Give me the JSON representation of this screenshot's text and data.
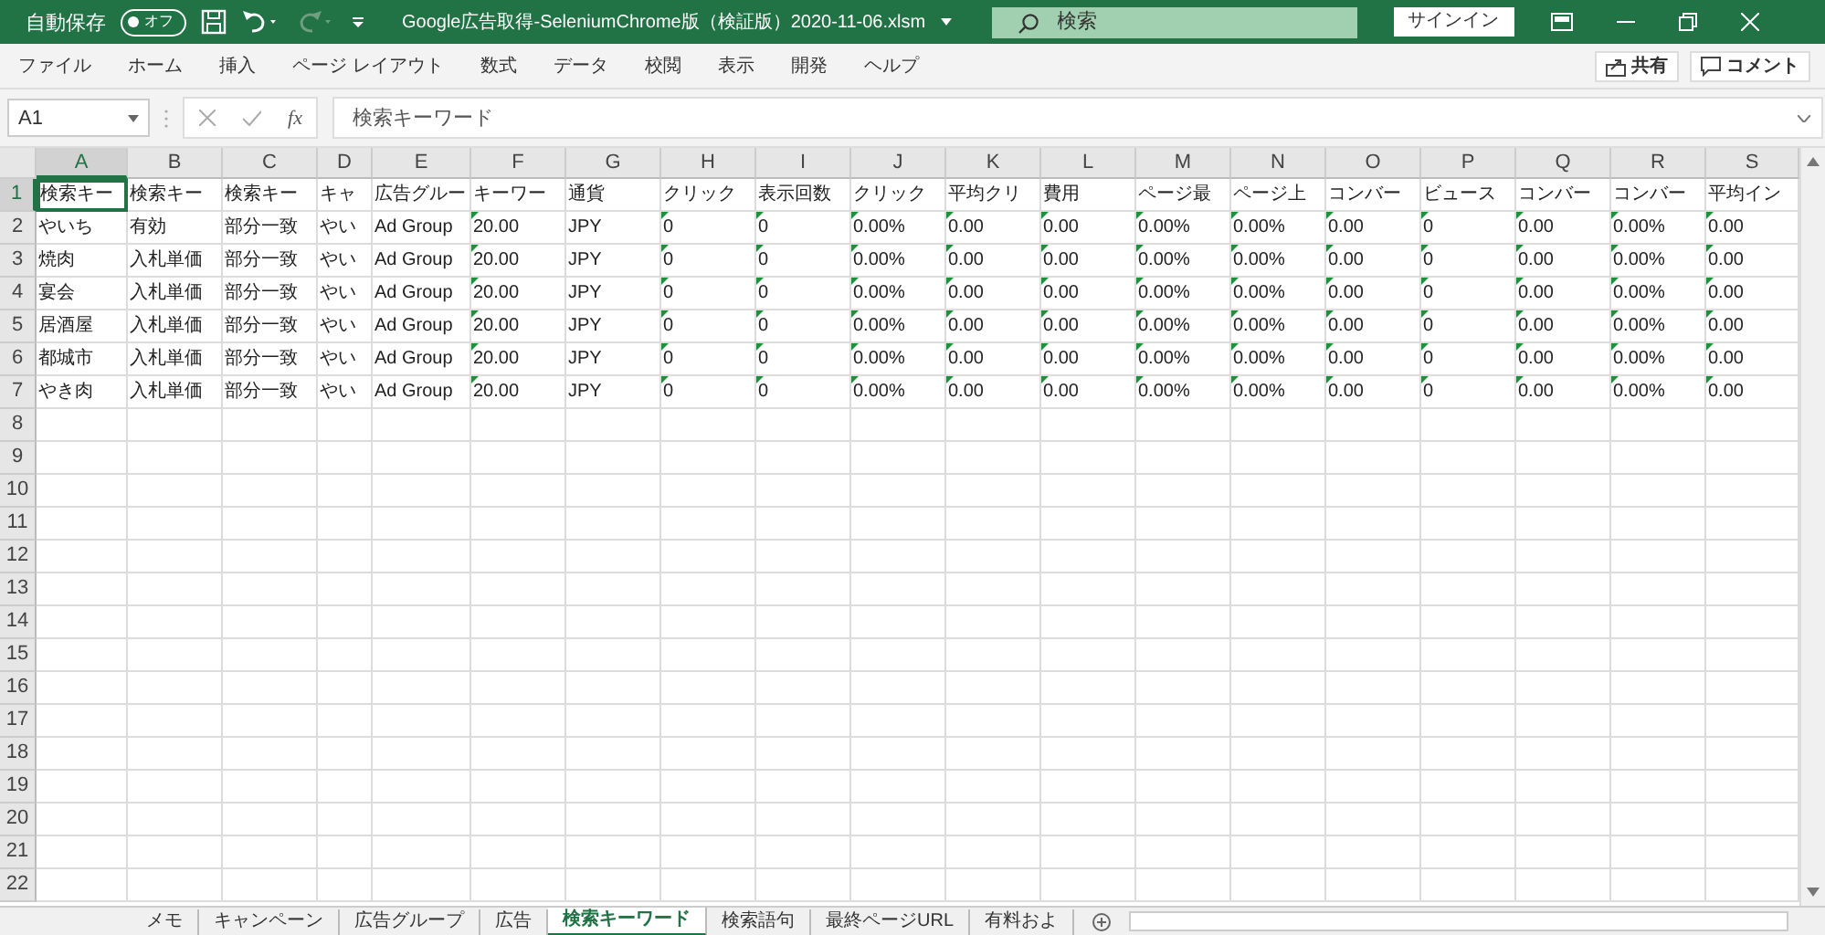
{
  "window": {
    "autosave_label": "自動保存",
    "autosave_toggle": {
      "label": "オフ",
      "on": false
    },
    "redo": {
      "disabled": true
    },
    "title": "Google広告取得-SeleniumChrome版（検証版）2020-11-06.xlsm",
    "search": {
      "placeholder": "検索"
    },
    "signin": "サインイン"
  },
  "menu": {
    "tabs": [
      "ファイル",
      "ホーム",
      "挿入",
      "ページ レイアウト",
      "数式",
      "データ",
      "校閲",
      "表示",
      "開発",
      "ヘルプ"
    ],
    "share": "共有",
    "comment": "コメント"
  },
  "formula_bar": {
    "name_box": "A1",
    "fx": "fx",
    "value": "検索キーワード"
  },
  "grid": {
    "columns": [
      {
        "letter": "A",
        "selected": true,
        "error_marker": false
      },
      {
        "letter": "B",
        "selected": false,
        "error_marker": false
      },
      {
        "letter": "C",
        "selected": false,
        "error_marker": false
      },
      {
        "letter": "D",
        "selected": false,
        "error_marker": false
      },
      {
        "letter": "E",
        "selected": false,
        "error_marker": false
      },
      {
        "letter": "F",
        "selected": false,
        "error_marker": true
      },
      {
        "letter": "G",
        "selected": false,
        "error_marker": false
      },
      {
        "letter": "H",
        "selected": false,
        "error_marker": true
      },
      {
        "letter": "I",
        "selected": false,
        "error_marker": true
      },
      {
        "letter": "J",
        "selected": false,
        "error_marker": true
      },
      {
        "letter": "K",
        "selected": false,
        "error_marker": true
      },
      {
        "letter": "L",
        "selected": false,
        "error_marker": true
      },
      {
        "letter": "M",
        "selected": false,
        "error_marker": true
      },
      {
        "letter": "N",
        "selected": false,
        "error_marker": true
      },
      {
        "letter": "O",
        "selected": false,
        "error_marker": true
      },
      {
        "letter": "P",
        "selected": false,
        "error_marker": true
      },
      {
        "letter": "Q",
        "selected": false,
        "error_marker": true
      },
      {
        "letter": "R",
        "selected": false,
        "error_marker": true
      },
      {
        "letter": "S",
        "selected": false,
        "error_marker": true
      }
    ],
    "rows": [
      {
        "number": "1",
        "selected": true,
        "cells": [
          "検索キー",
          "検索キー",
          "検索キー",
          "キャ",
          "広告グルー",
          "キーワー",
          "通貨",
          "クリック",
          "表示回数",
          "クリック",
          "平均クリ",
          "費用",
          "ページ最",
          "ページ上",
          "コンバー",
          "ビュース",
          "コンバー",
          "コンバー",
          "平均イン"
        ]
      },
      {
        "number": "2",
        "selected": false,
        "cells": [
          "やいち",
          "有効",
          "部分一致",
          "やい",
          "Ad Group",
          "20.00",
          "JPY",
          "0",
          "0",
          "0.00%",
          "0.00",
          "0.00",
          "0.00%",
          "0.00%",
          "0.00",
          "0",
          "0.00",
          "0.00%",
          "0.00"
        ]
      },
      {
        "number": "3",
        "selected": false,
        "cells": [
          "焼肉",
          "入札単価",
          "部分一致",
          "やい",
          "Ad Group",
          "20.00",
          "JPY",
          "0",
          "0",
          "0.00%",
          "0.00",
          "0.00",
          "0.00%",
          "0.00%",
          "0.00",
          "0",
          "0.00",
          "0.00%",
          "0.00"
        ]
      },
      {
        "number": "4",
        "selected": false,
        "cells": [
          "宴会",
          "入札単価",
          "部分一致",
          "やい",
          "Ad Group",
          "20.00",
          "JPY",
          "0",
          "0",
          "0.00%",
          "0.00",
          "0.00",
          "0.00%",
          "0.00%",
          "0.00",
          "0",
          "0.00",
          "0.00%",
          "0.00"
        ]
      },
      {
        "number": "5",
        "selected": false,
        "cells": [
          "居酒屋",
          "入札単価",
          "部分一致",
          "やい",
          "Ad Group",
          "20.00",
          "JPY",
          "0",
          "0",
          "0.00%",
          "0.00",
          "0.00",
          "0.00%",
          "0.00%",
          "0.00",
          "0",
          "0.00",
          "0.00%",
          "0.00"
        ]
      },
      {
        "number": "6",
        "selected": false,
        "cells": [
          "都城市",
          "入札単価",
          "部分一致",
          "やい",
          "Ad Group",
          "20.00",
          "JPY",
          "0",
          "0",
          "0.00%",
          "0.00",
          "0.00",
          "0.00%",
          "0.00%",
          "0.00",
          "0",
          "0.00",
          "0.00%",
          "0.00"
        ]
      },
      {
        "number": "7",
        "selected": false,
        "cells": [
          "やき肉",
          "入札単価",
          "部分一致",
          "やい",
          "Ad Group",
          "20.00",
          "JPY",
          "0",
          "0",
          "0.00%",
          "0.00",
          "0.00",
          "0.00%",
          "0.00%",
          "0.00",
          "0",
          "0.00",
          "0.00%",
          "0.00"
        ]
      },
      {
        "number": "8",
        "selected": false,
        "cells": []
      },
      {
        "number": "9",
        "selected": false,
        "cells": []
      },
      {
        "number": "10",
        "selected": false,
        "cells": []
      },
      {
        "number": "11",
        "selected": false,
        "cells": []
      },
      {
        "number": "12",
        "selected": false,
        "cells": []
      },
      {
        "number": "13",
        "selected": false,
        "cells": []
      },
      {
        "number": "14",
        "selected": false,
        "cells": []
      },
      {
        "number": "15",
        "selected": false,
        "cells": []
      },
      {
        "number": "16",
        "selected": false,
        "cells": []
      },
      {
        "number": "17",
        "selected": false,
        "cells": []
      },
      {
        "number": "18",
        "selected": false,
        "cells": []
      },
      {
        "number": "19",
        "selected": false,
        "cells": []
      },
      {
        "number": "20",
        "selected": false,
        "cells": []
      },
      {
        "number": "21",
        "selected": false,
        "cells": []
      },
      {
        "number": "22",
        "selected": false,
        "cells": []
      }
    ]
  },
  "sheet_tabs": [
    {
      "label": "メモ",
      "selected": false
    },
    {
      "label": "キャンペーン",
      "selected": false
    },
    {
      "label": "広告グループ",
      "selected": false
    },
    {
      "label": "広告",
      "selected": false
    },
    {
      "label": "検索キーワード",
      "selected": true
    },
    {
      "label": "検索語句",
      "selected": false
    },
    {
      "label": "最終ページURL",
      "selected": false
    },
    {
      "label": "有料およ",
      "selected": false
    }
  ]
}
